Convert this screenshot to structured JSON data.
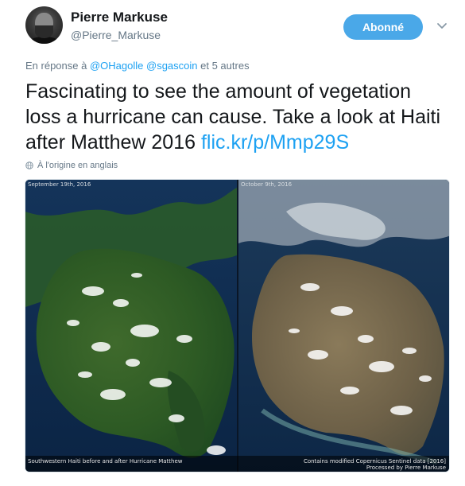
{
  "author": {
    "display_name": "Pierre Markuse",
    "screen_name": "@Pierre_Markuse"
  },
  "follow_button": {
    "label": "Abonné"
  },
  "reply": {
    "prefix": "En réponse à",
    "mention1": "@OHagolle",
    "mention2": "@sgascoin",
    "suffix": "et 5 autres"
  },
  "tweet": {
    "text": "Fascinating to see the amount of vegetation loss a hurricane can cause. Take a look at Haiti after Matthew 2016 ",
    "link": "flic.kr/p/Mmp29S"
  },
  "translation": {
    "label": "À l'origine en anglais",
    "icon": "globe-icon"
  },
  "media": {
    "left_date": "September 19th, 2016",
    "right_date": "October 9th, 2016",
    "caption": "Southwestern Haiti before and after Hurricane Matthew",
    "credit_line1": "Contains modified Copernicus Sentinel data [2016]",
    "credit_line2": "Processed by Pierre Markuse"
  },
  "colors": {
    "follow_button": "#4aa8e8",
    "link": "#1da1f2",
    "secondary_text": "#657786",
    "primary_text": "#14171a"
  }
}
